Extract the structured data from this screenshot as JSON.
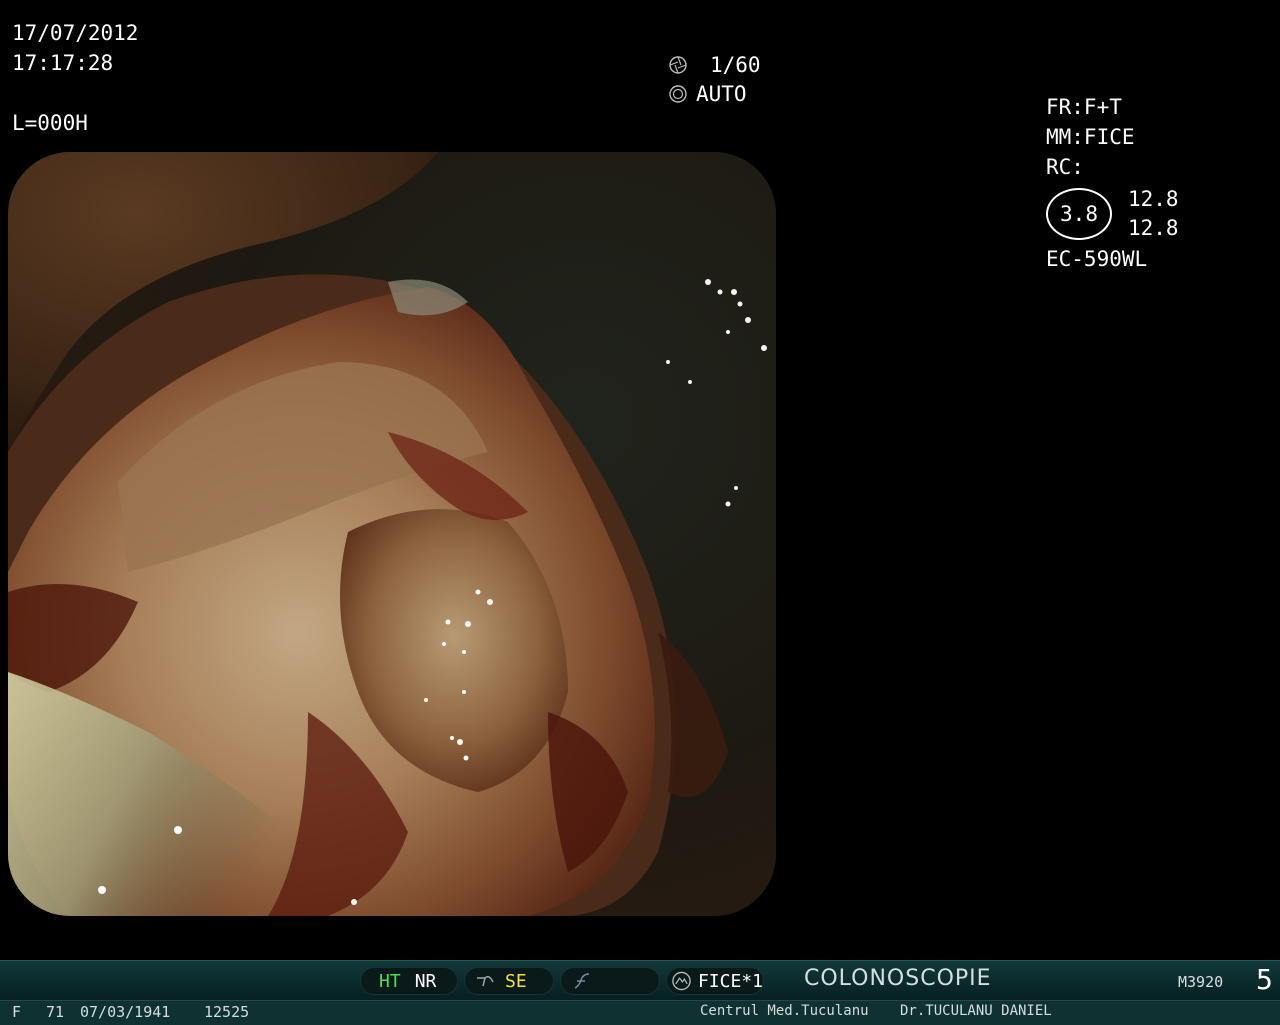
{
  "osd": {
    "date": "17/07/2012",
    "time": "17:17:28",
    "light": "L=000H",
    "shutter": "1/60",
    "iris": "AUTO",
    "fr": "FR:F+T",
    "mm": "MM:FICE",
    "rc": "RC:",
    "rc_badge": "3.8",
    "rc_value_1": "12.8",
    "rc_value_2": "12.8",
    "scope_model": "EC-590WL",
    "icons": {
      "shutter": "shutter-icon",
      "iris": "iris-icon"
    }
  },
  "status_bar": {
    "ht": "HT",
    "nr": "NR",
    "se": "SE",
    "fice": "FICE*1",
    "procedure": "COLONOSCOPIE",
    "model_code": "M3920",
    "channel": "5",
    "colors": {
      "ht": "#49e04a",
      "se": "#f4e23a"
    },
    "icons": {
      "se": "structure-enhance-icon",
      "f": "filter-icon",
      "fice": "fice-icon"
    }
  },
  "patient": {
    "sex": "F",
    "age": "71",
    "dob": "07/03/1941",
    "id": "12525",
    "clinic": "Centrul Med.Tuculanu",
    "doctor": "Dr.TUCULANU DANIEL"
  }
}
